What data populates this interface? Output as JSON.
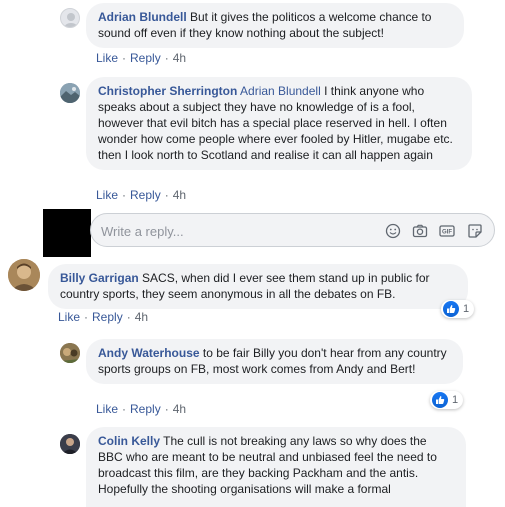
{
  "comments": [
    {
      "author": "Adrian Blundell",
      "mention": "",
      "text": " But it gives the politicos a welcome chance to sound off even if they know nothing about the subject!",
      "like": "Like",
      "reply": "Reply",
      "time": "4h"
    },
    {
      "author": "Christopher Sherrington",
      "mention": " Adrian Blundell",
      "text": " I think anyone who speaks about a subject they have no knowledge of is a fool, however that evil bitch has a special place reserved in hell. I often wonder how come people where ever fooled by Hitler, mugabe etc. then I look north to Scotland and realise it can all happen again",
      "like": "Like",
      "reply": "Reply",
      "time": "4h"
    },
    {
      "author": "Billy Garrigan",
      "mention": "",
      "text": " SACS, when did I ever see them stand up in public for country sports, they seem anonymous in all the debates on FB.",
      "like": "Like",
      "reply": "Reply",
      "time": "4h",
      "reaction_count": "1"
    },
    {
      "author": "Andy Waterhouse",
      "mention": "",
      "text": " to be fair Billy you don't hear from any country sports groups on FB, most work comes from Andy and Bert!",
      "like": "Like",
      "reply": "Reply",
      "time": "4h",
      "reaction_count": "1"
    },
    {
      "author": "Colin Kelly",
      "mention": "",
      "text": " The cull is not breaking any laws so why does the BBC who are meant to be neutral and unbiased feel the need to broadcast this film, are they backing Packham and the antis. Hopefully the shooting organisations will make a formal"
    }
  ],
  "reply_box": {
    "placeholder": "Write a reply..."
  },
  "icons": {
    "reply_box": [
      "emoji-icon",
      "camera-icon",
      "gif-icon",
      "sticker-icon"
    ],
    "reaction": "like-reaction-icon"
  },
  "colors": {
    "name": "#385898",
    "bubble": "#f2f3f5",
    "like_blue": "#1877f2"
  }
}
